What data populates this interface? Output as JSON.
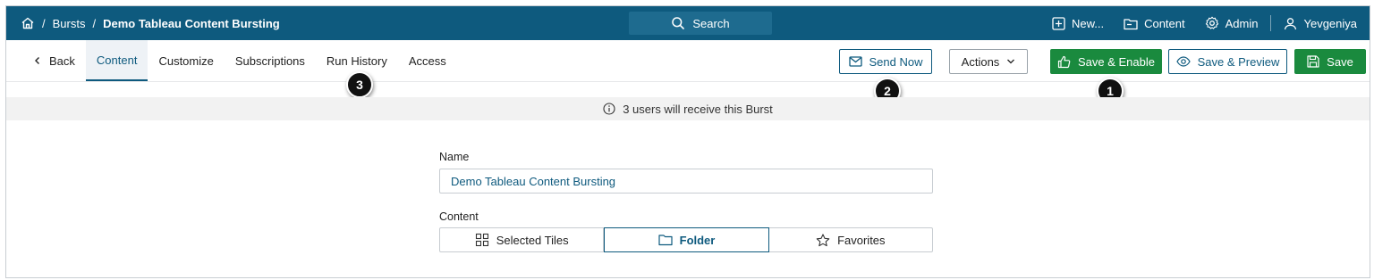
{
  "breadcrumb": {
    "separator": "/",
    "items": [
      "Bursts",
      "Demo Tableau Content Bursting"
    ]
  },
  "search": {
    "label": "Search"
  },
  "topnav": {
    "new_label": "New...",
    "content_label": "Content",
    "admin_label": "Admin",
    "user_label": "Yevgeniya"
  },
  "tabs": {
    "back": "Back",
    "items": [
      "Content",
      "Customize",
      "Subscriptions",
      "Run History",
      "Access"
    ],
    "active": "Content"
  },
  "actions": {
    "send_now": "Send Now",
    "actions": "Actions",
    "save_enable": "Save & Enable",
    "save_preview": "Save & Preview",
    "save": "Save"
  },
  "markers": [
    "1",
    "2",
    "3"
  ],
  "info": {
    "text": "3 users will receive this Burst"
  },
  "form": {
    "name_label": "Name",
    "name_value": "Demo Tableau Content Bursting",
    "content_label": "Content",
    "content_options": [
      "Selected Tiles",
      "Folder",
      "Favorites"
    ],
    "content_selected": "Folder"
  },
  "colors": {
    "brand": "#0e5a7e",
    "primary_green": "#1a8a3e",
    "info_bg": "#f2f2f2"
  },
  "icons": [
    "home-icon",
    "search-icon",
    "plus-square-icon",
    "folder-icon",
    "gear-icon",
    "user-icon",
    "chevron-left-icon",
    "envelope-icon",
    "chevron-down-icon",
    "thumbs-up-icon",
    "eye-icon",
    "save-icon",
    "info-icon",
    "grid-icon",
    "star-icon"
  ]
}
